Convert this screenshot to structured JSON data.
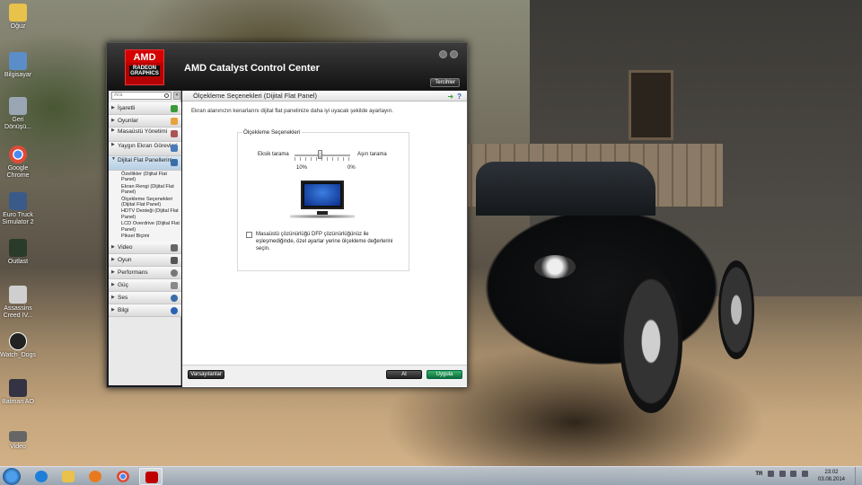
{
  "desktop": {
    "icons": [
      {
        "label": "Oğuz",
        "icon": "folder-icon",
        "color": "#e8c24a"
      },
      {
        "label": "Bilgisayar",
        "icon": "computer-icon",
        "color": "#5b8ec9"
      },
      {
        "label": "Geri Dönüşü...",
        "icon": "recycle-bin-icon",
        "color": "#9aa6b4"
      },
      {
        "label": "Google Chrome",
        "icon": "chrome-icon",
        "color": "#dd4b39"
      },
      {
        "label": "Euro Truck Simulator 2",
        "icon": "truck-icon",
        "color": "#3a5a8a"
      },
      {
        "label": "Outlast",
        "icon": "outlast-icon",
        "color": "#2b3b2b"
      },
      {
        "label": "Assassins Creed IV...",
        "icon": "assassins-creed-icon",
        "color": "#cfcfcf"
      },
      {
        "label": "Watch_Dogs",
        "icon": "watch-dogs-icon",
        "color": "#222222"
      },
      {
        "label": "Batman AO",
        "icon": "batman-icon",
        "color": "#333344"
      },
      {
        "label": "Video",
        "icon": "video-icon",
        "color": "#666666"
      }
    ]
  },
  "window": {
    "logo_amd": "AMD",
    "logo_radeon": "RADEON GRAPHICS",
    "title": "AMD Catalyst Control Center",
    "preferences_label": "Tercihler"
  },
  "sidebar": {
    "search_placeholder": "Ara",
    "collapse_label": "«",
    "items": [
      {
        "label": "İşaretli",
        "icon": "pin-icon",
        "color": "#3a9a3a"
      },
      {
        "label": "Oyunlar",
        "icon": "gamepad-icon",
        "color": "#e6a23c"
      },
      {
        "label": "Masaüstü Yönetimi",
        "icon": "desktop-manage-icon",
        "color": "#a55"
      },
      {
        "label": "Yaygın Ekran Görevleri",
        "icon": "display-tasks-icon",
        "color": "#4a7ab8"
      },
      {
        "label": "Dijital Flat Panellerim",
        "icon": "flat-panel-icon",
        "color": "#3a6ca8"
      }
    ],
    "subitems": [
      "Özellikler (Dijital Flat Panel)",
      "Ekran Rengi (Dijital Flat Panel)",
      "Ölçekleme Seçenekleri (Dijital Flat Panel)",
      "HDTV Desteği (Dijital Flat Panel)",
      "LCD Overdrive (Dijital Flat Panel)",
      "Piksel Biçimi"
    ],
    "bottom_items": [
      {
        "label": "Video",
        "icon": "video-camera-icon",
        "color": "#666"
      },
      {
        "label": "Oyun",
        "icon": "joystick-icon",
        "color": "#555"
      },
      {
        "label": "Performans",
        "icon": "gauge-icon",
        "color": "#777"
      },
      {
        "label": "Güç",
        "icon": "battery-icon",
        "color": "#888"
      },
      {
        "label": "Ses",
        "icon": "speaker-icon",
        "color": "#3a6ca8"
      },
      {
        "label": "Bilgi",
        "icon": "info-icon",
        "color": "#2a62b6"
      }
    ]
  },
  "content": {
    "title": "Ölçekleme Seçenekleri (Dijital Flat Panel)",
    "description": "Ekran alanınızın kenarlarını dijital flat panelinize daha iyi uyacak şekilde ayarlayın.",
    "group_title": "Ölçekleme Seçenekleri",
    "slider_left": "Eksik tarama",
    "slider_right": "Aşırı tarama",
    "value_left": "10%",
    "value_right": "0%",
    "checkbox_label": "Masaüstü çözünürlüğü DFP çözünürlüğünüz ile eşleşmediğinde, özel ayarlar yerine ölçekleme değerlerini seçin.",
    "checkbox_checked": false
  },
  "footer": {
    "defaults_label": "Varsayılanlar",
    "cancel_label": "At",
    "apply_label": "Uygula"
  },
  "taskbar": {
    "apps": [
      {
        "name": "internet-explorer-icon",
        "color": "#1e7fd8"
      },
      {
        "name": "file-explorer-icon",
        "color": "#e8c24a"
      },
      {
        "name": "media-player-icon",
        "color": "#e87a1e"
      },
      {
        "name": "chrome-icon",
        "color": "#dd4b39"
      },
      {
        "name": "amd-catalyst-icon",
        "color": "#c00000"
      }
    ],
    "language": "TR",
    "time": "23:02",
    "date": "03.08.2014"
  }
}
